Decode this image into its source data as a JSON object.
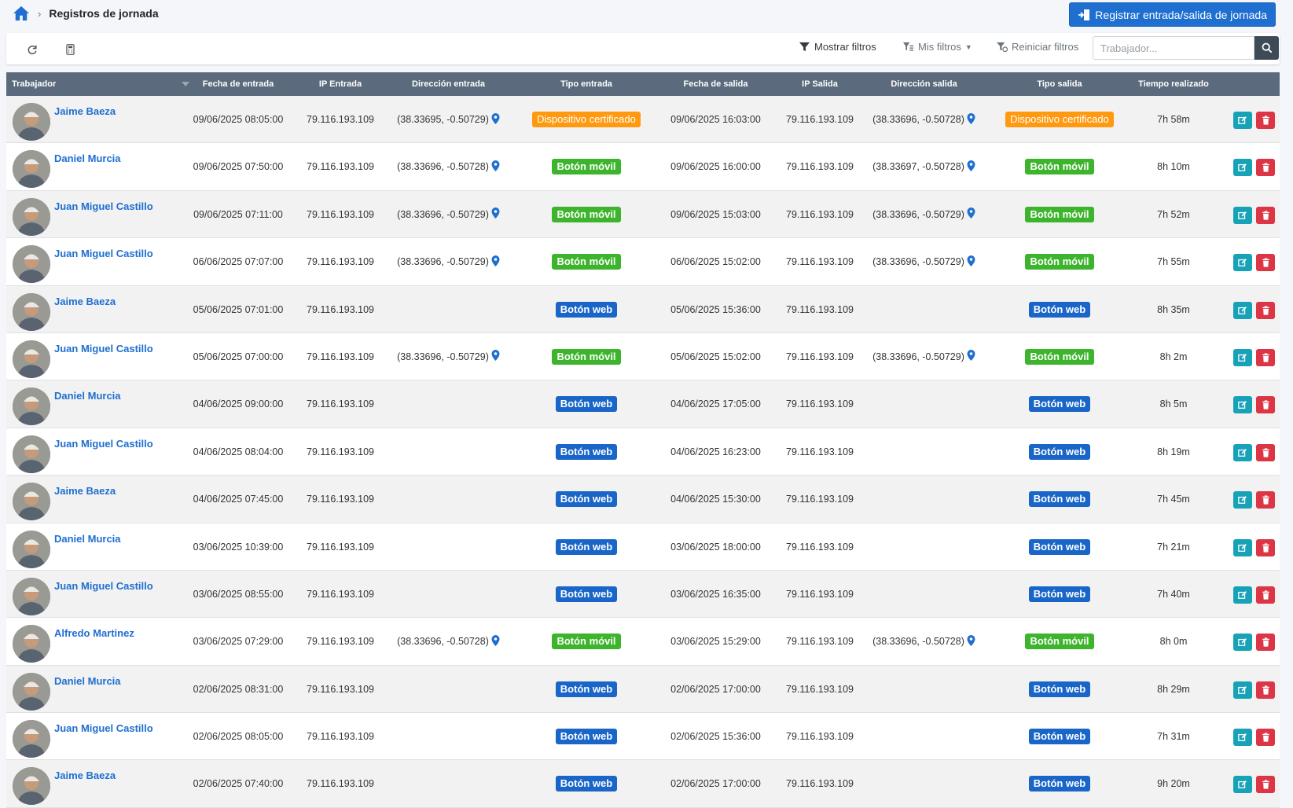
{
  "breadcrumb": {
    "title": "Registros de jornada"
  },
  "header": {
    "register_label": "Registrar entrada/salida de jornada"
  },
  "toolbar": {
    "show_filters": "Mostrar filtros",
    "my_filters": "Mis filtros",
    "reset_filters": "Reiniciar filtros",
    "search_placeholder": "Trabajador...",
    "icons": [
      "refresh-icon",
      "calculator-icon",
      "filter-icon",
      "filter-list-icon",
      "filter-reset-icon",
      "search-icon"
    ]
  },
  "colors": {
    "accent": "#1e6fd0",
    "header_bg": "#5b6a7c",
    "certificado": "#ff9a10",
    "movil": "#3cb42c",
    "web": "#1a66c8",
    "edit": "#17a2b8",
    "delete": "#dc3545"
  },
  "columns": [
    "Trabajador",
    "Fecha de entrada",
    "IP Entrada",
    "Dirección entrada",
    "Tipo entrada",
    "Fecha de salida",
    "IP Salida",
    "Dirección salida",
    "Tipo salida",
    "Tiempo realizado"
  ],
  "rows": [
    {
      "worker": "Jaime Baeza",
      "in_date": "09/06/2025 08:05:00",
      "in_ip": "79.116.193.109",
      "in_addr": "(38.33695, -0.50729)",
      "in_type": "Dispositivo certificado",
      "out_date": "09/06/2025 16:03:00",
      "out_ip": "79.116.193.109",
      "out_addr": "(38.33696, -0.50728)",
      "out_type": "Dispositivo certificado",
      "time": "7h 58m"
    },
    {
      "worker": "Daniel Murcia",
      "in_date": "09/06/2025 07:50:00",
      "in_ip": "79.116.193.109",
      "in_addr": "(38.33696, -0.50728)",
      "in_type": "Botón móvil",
      "out_date": "09/06/2025 16:00:00",
      "out_ip": "79.116.193.109",
      "out_addr": "(38.33697, -0.50728)",
      "out_type": "Botón móvil",
      "time": "8h 10m"
    },
    {
      "worker": "Juan Miguel Castillo",
      "in_date": "09/06/2025 07:11:00",
      "in_ip": "79.116.193.109",
      "in_addr": "(38.33696, -0.50729)",
      "in_type": "Botón móvil",
      "out_date": "09/06/2025 15:03:00",
      "out_ip": "79.116.193.109",
      "out_addr": "(38.33696, -0.50729)",
      "out_type": "Botón móvil",
      "time": "7h 52m"
    },
    {
      "worker": "Juan Miguel Castillo",
      "in_date": "06/06/2025 07:07:00",
      "in_ip": "79.116.193.109",
      "in_addr": "(38.33696, -0.50729)",
      "in_type": "Botón móvil",
      "out_date": "06/06/2025 15:02:00",
      "out_ip": "79.116.193.109",
      "out_addr": "(38.33696, -0.50729)",
      "out_type": "Botón móvil",
      "time": "7h 55m"
    },
    {
      "worker": "Jaime Baeza",
      "in_date": "05/06/2025 07:01:00",
      "in_ip": "79.116.193.109",
      "in_addr": "",
      "in_type": "Botón web",
      "out_date": "05/06/2025 15:36:00",
      "out_ip": "79.116.193.109",
      "out_addr": "",
      "out_type": "Botón web",
      "time": "8h 35m"
    },
    {
      "worker": "Juan Miguel Castillo",
      "in_date": "05/06/2025 07:00:00",
      "in_ip": "79.116.193.109",
      "in_addr": "(38.33696, -0.50729)",
      "in_type": "Botón móvil",
      "out_date": "05/06/2025 15:02:00",
      "out_ip": "79.116.193.109",
      "out_addr": "(38.33696, -0.50729)",
      "out_type": "Botón móvil",
      "time": "8h 2m"
    },
    {
      "worker": "Daniel Murcia",
      "in_date": "04/06/2025 09:00:00",
      "in_ip": "79.116.193.109",
      "in_addr": "",
      "in_type": "Botón web",
      "out_date": "04/06/2025 17:05:00",
      "out_ip": "79.116.193.109",
      "out_addr": "",
      "out_type": "Botón web",
      "time": "8h 5m"
    },
    {
      "worker": "Juan Miguel Castillo",
      "in_date": "04/06/2025 08:04:00",
      "in_ip": "79.116.193.109",
      "in_addr": "",
      "in_type": "Botón web",
      "out_date": "04/06/2025 16:23:00",
      "out_ip": "79.116.193.109",
      "out_addr": "",
      "out_type": "Botón web",
      "time": "8h 19m"
    },
    {
      "worker": "Jaime Baeza",
      "in_date": "04/06/2025 07:45:00",
      "in_ip": "79.116.193.109",
      "in_addr": "",
      "in_type": "Botón web",
      "out_date": "04/06/2025 15:30:00",
      "out_ip": "79.116.193.109",
      "out_addr": "",
      "out_type": "Botón web",
      "time": "7h 45m"
    },
    {
      "worker": "Daniel Murcia",
      "in_date": "03/06/2025 10:39:00",
      "in_ip": "79.116.193.109",
      "in_addr": "",
      "in_type": "Botón web",
      "out_date": "03/06/2025 18:00:00",
      "out_ip": "79.116.193.109",
      "out_addr": "",
      "out_type": "Botón web",
      "time": "7h 21m"
    },
    {
      "worker": "Juan Miguel Castillo",
      "in_date": "03/06/2025 08:55:00",
      "in_ip": "79.116.193.109",
      "in_addr": "",
      "in_type": "Botón web",
      "out_date": "03/06/2025 16:35:00",
      "out_ip": "79.116.193.109",
      "out_addr": "",
      "out_type": "Botón web",
      "time": "7h 40m"
    },
    {
      "worker": "Alfredo Martinez",
      "in_date": "03/06/2025 07:29:00",
      "in_ip": "79.116.193.109",
      "in_addr": "(38.33696, -0.50728)",
      "in_type": "Botón móvil",
      "out_date": "03/06/2025 15:29:00",
      "out_ip": "79.116.193.109",
      "out_addr": "(38.33696, -0.50728)",
      "out_type": "Botón móvil",
      "time": "8h 0m"
    },
    {
      "worker": "Daniel Murcia",
      "in_date": "02/06/2025 08:31:00",
      "in_ip": "79.116.193.109",
      "in_addr": "",
      "in_type": "Botón web",
      "out_date": "02/06/2025 17:00:00",
      "out_ip": "79.116.193.109",
      "out_addr": "",
      "out_type": "Botón web",
      "time": "8h 29m"
    },
    {
      "worker": "Juan Miguel Castillo",
      "in_date": "02/06/2025 08:05:00",
      "in_ip": "79.116.193.109",
      "in_addr": "",
      "in_type": "Botón web",
      "out_date": "02/06/2025 15:36:00",
      "out_ip": "79.116.193.109",
      "out_addr": "",
      "out_type": "Botón web",
      "time": "7h 31m"
    },
    {
      "worker": "Jaime Baeza",
      "in_date": "02/06/2025 07:40:00",
      "in_ip": "79.116.193.109",
      "in_addr": "",
      "in_type": "Botón web",
      "out_date": "02/06/2025 17:00:00",
      "out_ip": "79.116.193.109",
      "out_addr": "",
      "out_type": "Botón web",
      "time": "9h 20m"
    }
  ]
}
